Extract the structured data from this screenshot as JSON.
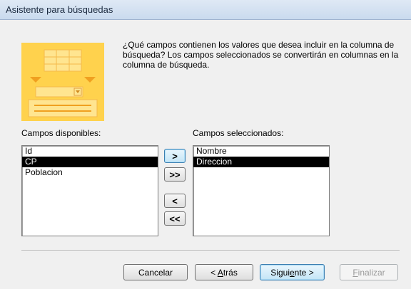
{
  "window": {
    "title": "Asistente para búsquedas"
  },
  "description": "¿Qué campos contienen los valores que desea incluir en la columna de búsqueda? Los campos seleccionados se convertirán en columnas en la columna de búsqueda.",
  "available": {
    "label": "Campos disponibles:",
    "items": [
      "Id",
      "CP",
      "Poblacion"
    ],
    "selected_index": 1
  },
  "selected": {
    "label": "Campos seleccionados:",
    "items": [
      "Nombre",
      "Direccion"
    ],
    "selected_index": 1
  },
  "move_buttons": {
    "add": ">",
    "add_all": ">>",
    "remove": "<",
    "remove_all": "<<"
  },
  "footer": {
    "cancel": "Cancelar",
    "back_prefix": "< ",
    "back_mnemonic": "A",
    "back_rest": "trás",
    "next_prefix": "Sigui",
    "next_mnemonic": "e",
    "next_rest": "nte >",
    "finish_mnemonic": "F",
    "finish_rest": "inalizar"
  },
  "colors": {
    "illustration_bg": "#ffd24d",
    "illustration_accent": "#f0a020",
    "selection_bg": "#000000"
  },
  "icons": {
    "illustration": "lookup-wizard-illustration"
  }
}
